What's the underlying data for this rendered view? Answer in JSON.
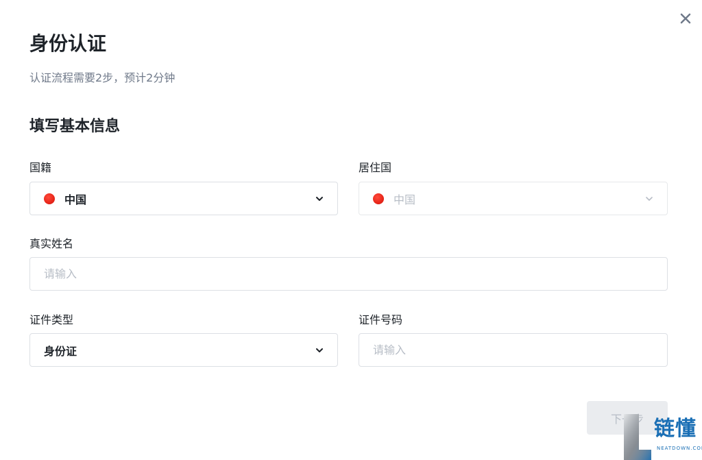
{
  "dialog": {
    "title": "身份认证",
    "subtitle": "认证流程需要2步，预计2分钟",
    "section_title": "填写基本信息"
  },
  "form": {
    "nationality": {
      "label": "国籍",
      "value": "中国",
      "flag": "china-flag-icon"
    },
    "residence": {
      "label": "居住国",
      "value": "中国",
      "flag": "china-flag-icon",
      "disabled": true
    },
    "real_name": {
      "label": "真实姓名",
      "placeholder": "请输入",
      "value": ""
    },
    "id_type": {
      "label": "证件类型",
      "value": "身份证"
    },
    "id_number": {
      "label": "证件号码",
      "placeholder": "请输入",
      "value": ""
    }
  },
  "actions": {
    "next_label": "下一步"
  },
  "watermark": {
    "text": "链懂",
    "subtext": "NEATDOWN.COM"
  },
  "colors": {
    "text_primary": "#1e2329",
    "text_secondary": "#707a8a",
    "placeholder": "#b7bdc6",
    "border": "#dcdfe4",
    "button_disabled_bg": "#eaecef",
    "flag_red": "#e8261a",
    "watermark_blue": "#1a6fb5"
  }
}
